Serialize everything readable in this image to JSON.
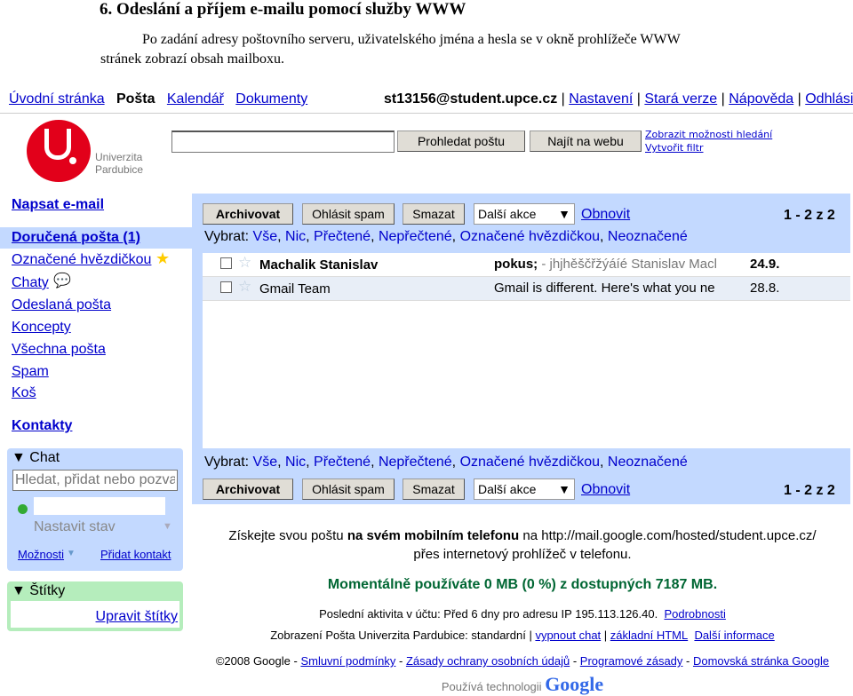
{
  "doc": {
    "heading": "6.  Odeslání a příjem e-mailu pomocí služby WWW",
    "para_line1": "Po zadání adresy poštovního serveru, uživatelského jména a hesla se v okně prohlížeče WWW",
    "para_line2": "stránek zobrazí obsah mailboxu."
  },
  "topnav": {
    "left": [
      "Úvodní stránka",
      "Pošta",
      "Kalendář",
      "Dokumenty"
    ],
    "user": "st13156@student.upce.cz",
    "right": [
      "Nastavení",
      "Stará verze",
      "Nápověda",
      "Odhlásit"
    ]
  },
  "logo": {
    "line1": "Univerzita",
    "line2": "Pardubice",
    "color": "#e2001a"
  },
  "search": {
    "value": "",
    "search_mail": "Prohledat poštu",
    "search_web": "Najít na webu",
    "options": "Zobrazit možnosti hledání",
    "filter": "Vytvořit filtr"
  },
  "sidebar": {
    "compose": "Napsat e-mail",
    "items": [
      "Doručená pošta (1)",
      "Označené hvězdičkou",
      "Chaty",
      "Odeslaná pošta",
      "Koncepty",
      "Všechna pošta",
      "Spam",
      "Koš"
    ],
    "contacts": "Kontakty"
  },
  "chat": {
    "title": "Chat",
    "placeholder": "Hledat, přidat nebo pozvat",
    "status": "Nastavit stav",
    "options": "Možnosti",
    "add": "Přidat kontakt"
  },
  "labels": {
    "title": "Štítky",
    "edit": "Upravit štítky"
  },
  "toolbar": {
    "archive": "Archivovat",
    "spam": "Ohlásit spam",
    "delete": "Smazat",
    "more": "Další akce",
    "refresh": "Obnovit",
    "count": "1 - 2 z 2"
  },
  "select": {
    "label": "Vybrat:",
    "options": [
      "Vše",
      "Nic",
      "Přečtené",
      "Nepřečtené",
      "Označené hvězdičkou",
      "Neoznačené"
    ]
  },
  "messages": [
    {
      "from": "Machalik Stanislav",
      "subject": "pokus;",
      "snippet": " - jhjhěščřžýáíé Stanislav Macl",
      "date": "24.9.",
      "unread": true
    },
    {
      "from": "Gmail Team",
      "subject": "Gmail is different. Here's what you ne",
      "snippet": "",
      "date": "28.8.",
      "unread": false
    }
  ],
  "footer": {
    "mobile_a": "Získejte svou poštu ",
    "mobile_b": "na svém mobilním telefonu",
    "mobile_c": " na http://mail.google.com/hosted/student.upce.cz/",
    "mobile_line2": "přes internetový prohlížeč v telefonu.",
    "quota": "Momentálně používáte 0 MB (0 %) z dostupných 7187 MB.",
    "activity": "Poslední aktivita v účtu: Před 6 dny pro adresu IP 195.113.126.40.",
    "details": "Podrobnosti",
    "view": "Zobrazení Pošta Univerzita Pardubice: standardní |",
    "chat_off": "vypnout chat",
    "basic": "základní HTML",
    "more_info": "Další informace",
    "copyright": "©2008 Google -",
    "links": [
      "Smluvní podmínky",
      "Zásady ochrany osobních údajů",
      "Programové zásady",
      "Domovská stránka Google"
    ],
    "powered": "Používá technologii",
    "google": "Google"
  }
}
